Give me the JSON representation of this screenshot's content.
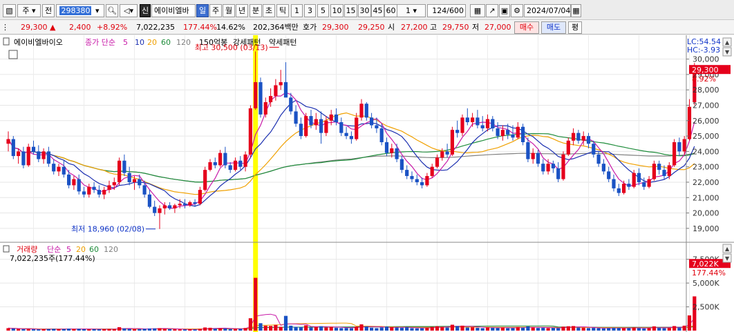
{
  "toolbar": {
    "market": "주",
    "prefix": "전",
    "code": "298380",
    "name_badge": "신",
    "name": "에이비엘바",
    "periods": [
      "일",
      "주",
      "월",
      "년",
      "분",
      "초",
      "틱"
    ],
    "active_period": "일",
    "intervals": [
      "1",
      "3",
      "5",
      "10",
      "15",
      "30",
      "45",
      "60"
    ],
    "interval_select": "1",
    "count": "124",
    "count_total": "/600",
    "date": "2024/07/04"
  },
  "info": {
    "price": "29,300",
    "change_arrow": "▲",
    "change": "2,400",
    "change_pct": "+8.92%",
    "volume": "7,022,235",
    "volume_ratio": "177.44%",
    "turnover_rate": "14.62%",
    "amount": "202,364백만",
    "quote_label": "호가",
    "ask": "29,300",
    "bid": "29,250",
    "open_label": "시",
    "open": "27,200",
    "high_label": "고",
    "high": "29,750",
    "low_label": "저",
    "low": "27,000",
    "buy_label": "매수",
    "sell_label": "매도",
    "eval_label": "평"
  },
  "colors": {
    "up": "#e5001c",
    "down": "#1a52c4",
    "ma5": "#c81aa8",
    "ma10": "#1b2fb0",
    "ma20": "#f0a000",
    "ma60": "#1e8c3a",
    "ma120": "#808080",
    "highlight": "#ffff00"
  },
  "chart_data": {
    "type": "candlestick",
    "price_legend": {
      "name": "에이비엘바이오",
      "label": "종가 단순",
      "periods": [
        "5",
        "10",
        "20",
        "60",
        "120"
      ],
      "extras": [
        "150억봉",
        "강세패턴",
        "약세패턴"
      ]
    },
    "lc_label": "LC:54.54",
    "hc_label": "HC:-3.93",
    "high_annotation": "최고 30,500 (03/13)",
    "low_annotation": "최저 18,960 (02/08)",
    "current_price_tag": "29,300",
    "current_pct_tag": "8.92%",
    "price_ticks": [
      "19,000",
      "20,000",
      "21,000",
      "22,000",
      "23,000",
      "24,000",
      "25,000",
      "26,000",
      "27,000",
      "28,000",
      "29,000",
      "30,000"
    ],
    "price_ylim": [
      18500,
      30700
    ],
    "volume_legend": {
      "label": "거래량",
      "type": "단순",
      "periods": [
        "5",
        "20",
        "60",
        "120"
      ]
    },
    "volume_readout": "7,022,235주(177.44%)",
    "volume_ticks": [
      "2,500K",
      "5,000K",
      "7,500K"
    ],
    "current_volume_tag": "7,022K",
    "current_volume_pct": "177.44%",
    "candles": [
      [
        24500,
        25300,
        24000,
        24800
      ],
      [
        24800,
        25000,
        23500,
        23700
      ],
      [
        23700,
        24200,
        23200,
        24000
      ],
      [
        24000,
        24300,
        22900,
        23100
      ],
      [
        23100,
        24500,
        23000,
        24300
      ],
      [
        24300,
        24700,
        23800,
        24000
      ],
      [
        24000,
        24400,
        23300,
        23500
      ],
      [
        23500,
        24200,
        23200,
        24000
      ],
      [
        24000,
        24300,
        23000,
        23200
      ],
      [
        23200,
        23500,
        22500,
        22700
      ],
      [
        22700,
        23200,
        22400,
        23000
      ],
      [
        23000,
        23400,
        22300,
        22500
      ],
      [
        22500,
        22800,
        21600,
        21800
      ],
      [
        21800,
        22400,
        21500,
        22200
      ],
      [
        22200,
        22500,
        21200,
        21400
      ],
      [
        21400,
        21700,
        21000,
        21200
      ],
      [
        21200,
        21900,
        21000,
        21700
      ],
      [
        21700,
        22000,
        21300,
        21500
      ],
      [
        21500,
        21800,
        21000,
        21200
      ],
      [
        21200,
        21700,
        20900,
        21500
      ],
      [
        21500,
        22100,
        21300,
        21800
      ],
      [
        21800,
        22300,
        21500,
        22000
      ],
      [
        22000,
        23600,
        21800,
        23400
      ],
      [
        23400,
        23800,
        22400,
        22600
      ],
      [
        22600,
        23000,
        21800,
        22000
      ],
      [
        22000,
        22400,
        21500,
        22200
      ],
      [
        22200,
        22500,
        21600,
        21800
      ],
      [
        21800,
        22100,
        21000,
        21200
      ],
      [
        21200,
        21500,
        20300,
        20400
      ],
      [
        20400,
        20800,
        19800,
        20000
      ],
      [
        20000,
        20500,
        18960,
        20300
      ],
      [
        20300,
        20700,
        19900,
        20500
      ],
      [
        20500,
        20700,
        20200,
        20300
      ],
      [
        20300,
        20600,
        20000,
        20500
      ],
      [
        20500,
        20900,
        20300,
        20600
      ],
      [
        20600,
        20900,
        20300,
        20500
      ],
      [
        20500,
        20800,
        20400,
        20700
      ],
      [
        20700,
        20900,
        20400,
        20600
      ],
      [
        20600,
        21700,
        20500,
        21500
      ],
      [
        21500,
        23000,
        21400,
        22800
      ],
      [
        22800,
        23500,
        22700,
        23300
      ],
      [
        23300,
        23600,
        22900,
        23100
      ],
      [
        23100,
        24100,
        23000,
        23900
      ],
      [
        23900,
        24300,
        22900,
        23100
      ],
      [
        23100,
        23300,
        22600,
        22800
      ],
      [
        22800,
        23600,
        22700,
        23400
      ],
      [
        23400,
        23700,
        22800,
        23000
      ],
      [
        23000,
        24000,
        22700,
        23800
      ],
      [
        23800,
        27000,
        23600,
        26800
      ],
      [
        26800,
        30500,
        26700,
        28500
      ],
      [
        28500,
        28800,
        26200,
        26400
      ],
      [
        26400,
        27500,
        26200,
        27200
      ],
      [
        27200,
        28100,
        26900,
        27600
      ],
      [
        27600,
        28700,
        27300,
        28300
      ],
      [
        28300,
        29300,
        28000,
        28500
      ],
      [
        28500,
        29800,
        28200,
        27500
      ],
      [
        27500,
        27800,
        26400,
        26600
      ],
      [
        26600,
        27000,
        25600,
        25800
      ],
      [
        25800,
        26200,
        24800,
        25000
      ],
      [
        25000,
        26500,
        24900,
        26300
      ],
      [
        26300,
        26700,
        25500,
        25700
      ],
      [
        25700,
        26500,
        25400,
        26100
      ],
      [
        26100,
        26600,
        24500,
        25200
      ],
      [
        25200,
        26300,
        25000,
        26000
      ],
      [
        26000,
        26700,
        25700,
        26400
      ],
      [
        26400,
        26800,
        25700,
        25900
      ],
      [
        25900,
        26200,
        25000,
        25200
      ],
      [
        25200,
        25600,
        24800,
        25000
      ],
      [
        25000,
        25300,
        24500,
        24800
      ],
      [
        24800,
        26500,
        24700,
        26200
      ],
      [
        26200,
        27400,
        26000,
        27100
      ],
      [
        27100,
        27200,
        26000,
        26200
      ],
      [
        26200,
        26500,
        25500,
        25700
      ],
      [
        25700,
        26200,
        25200,
        25500
      ],
      [
        25500,
        25800,
        24400,
        24600
      ],
      [
        24600,
        24900,
        23700,
        23900
      ],
      [
        23900,
        24500,
        23600,
        24200
      ],
      [
        24200,
        24500,
        23300,
        23500
      ],
      [
        23500,
        23700,
        22600,
        22800
      ],
      [
        22800,
        23100,
        22200,
        22400
      ],
      [
        22400,
        22700,
        22000,
        22200
      ],
      [
        22200,
        22500,
        21800,
        22000
      ],
      [
        22000,
        22300,
        21600,
        21800
      ],
      [
        21800,
        22600,
        21700,
        22400
      ],
      [
        22400,
        23200,
        22300,
        23000
      ],
      [
        23000,
        23800,
        22900,
        23600
      ],
      [
        23600,
        24200,
        23400,
        24000
      ],
      [
        24000,
        24500,
        23600,
        23800
      ],
      [
        23800,
        25600,
        23700,
        25400
      ],
      [
        25400,
        26000,
        24900,
        25200
      ],
      [
        25200,
        26400,
        25000,
        26200
      ],
      [
        26200,
        26800,
        25700,
        25900
      ],
      [
        25900,
        26500,
        25600,
        26200
      ],
      [
        26200,
        26700,
        25500,
        25700
      ],
      [
        25700,
        26300,
        25300,
        25500
      ],
      [
        25500,
        26400,
        25300,
        26100
      ],
      [
        26100,
        26300,
        25300,
        25500
      ],
      [
        25500,
        25900,
        24800,
        25000
      ],
      [
        25000,
        25700,
        24700,
        25400
      ],
      [
        25400,
        25800,
        24800,
        25100
      ],
      [
        25100,
        25700,
        24700,
        24900
      ],
      [
        24900,
        25900,
        24800,
        25600
      ],
      [
        25600,
        25800,
        24400,
        24600
      ],
      [
        24600,
        24900,
        23300,
        23500
      ],
      [
        23500,
        24200,
        23200,
        23900
      ],
      [
        23900,
        24100,
        23000,
        23200
      ],
      [
        23200,
        23500,
        22500,
        22700
      ],
      [
        22700,
        23500,
        22500,
        23200
      ],
      [
        23200,
        23400,
        22600,
        22900
      ],
      [
        22900,
        23300,
        22000,
        22200
      ],
      [
        22200,
        24000,
        22100,
        23800
      ],
      [
        23800,
        24900,
        23700,
        24700
      ],
      [
        24700,
        25500,
        24400,
        25200
      ],
      [
        25200,
        25400,
        24500,
        24700
      ],
      [
        24700,
        25300,
        24400,
        25000
      ],
      [
        25000,
        25200,
        24200,
        24500
      ],
      [
        24500,
        24700,
        23600,
        23800
      ],
      [
        23800,
        24000,
        23000,
        23200
      ],
      [
        23200,
        23500,
        22500,
        22700
      ],
      [
        22700,
        23000,
        22000,
        22200
      ],
      [
        22200,
        22500,
        21400,
        21600
      ],
      [
        21600,
        21900,
        21100,
        21300
      ],
      [
        21300,
        22100,
        21200,
        21900
      ],
      [
        21900,
        22200,
        21500,
        21700
      ],
      [
        21700,
        22800,
        21600,
        22600
      ],
      [
        22600,
        22900,
        21800,
        22000
      ],
      [
        22000,
        22300,
        21500,
        21700
      ],
      [
        21700,
        22400,
        21600,
        22200
      ],
      [
        22200,
        23400,
        22100,
        23200
      ],
      [
        23200,
        23400,
        22500,
        22800
      ],
      [
        22800,
        23100,
        22200,
        22400
      ],
      [
        22400,
        23300,
        22200,
        23100
      ],
      [
        23100,
        24800,
        23000,
        24600
      ],
      [
        24600,
        24900,
        23700,
        24000
      ],
      [
        24000,
        25000,
        23800,
        24800
      ],
      [
        24800,
        27400,
        24700,
        26900
      ],
      [
        27200,
        29750,
        27000,
        29300
      ]
    ],
    "volumes": [
      260,
      220,
      180,
      150,
      170,
      140,
      130,
      150,
      160,
      190,
      150,
      160,
      210,
      170,
      190,
      150,
      140,
      150,
      130,
      160,
      180,
      160,
      360,
      230,
      180,
      150,
      160,
      190,
      230,
      240,
      260,
      200,
      150,
      140,
      130,
      120,
      130,
      120,
      190,
      330,
      300,
      210,
      250,
      230,
      170,
      200,
      180,
      280,
      1300,
      5550,
      780,
      520,
      490,
      600,
      400,
      1550,
      520,
      400,
      380,
      560,
      330,
      380,
      460,
      330,
      400,
      300,
      270,
      280,
      260,
      430,
      660,
      440,
      300,
      260,
      330,
      420,
      360,
      330,
      300,
      350,
      260,
      240,
      250,
      300,
      390,
      460,
      400,
      330,
      620,
      470,
      520,
      330,
      360,
      300,
      260,
      350,
      300,
      280,
      330,
      260,
      270,
      380,
      320,
      440,
      330,
      280,
      300,
      270,
      290,
      260,
      420,
      460,
      480,
      330,
      300,
      270,
      290,
      260,
      240,
      260,
      300,
      280,
      260,
      270,
      330,
      260,
      230,
      260,
      450,
      300,
      260,
      280,
      480,
      330,
      520,
      1600,
      3600
    ]
  }
}
